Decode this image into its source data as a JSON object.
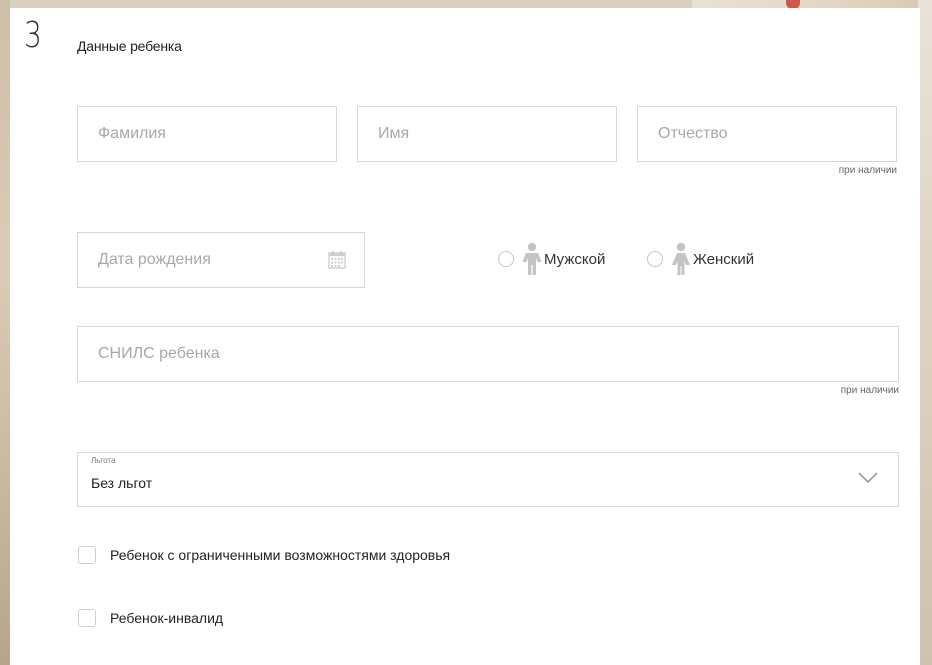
{
  "section": {
    "step": "3",
    "title": "Данные ребенка"
  },
  "fields": {
    "last_name_placeholder": "Фамилия",
    "first_name_placeholder": "Имя",
    "patronymic_placeholder": "Отчество",
    "patronymic_hint": "при наличии",
    "birth_date_placeholder": "Дата рождения",
    "snils_placeholder": "СНИЛС ребенка",
    "snils_hint": "при наличии"
  },
  "gender": {
    "male_label": "Мужской",
    "female_label": "Женский"
  },
  "benefit": {
    "label": "Льгота",
    "value": "Без льгот"
  },
  "checkboxes": {
    "limited_health": "Ребенок с ограниченными возможностями здоровья",
    "disabled": "Ребенок-инвалид"
  }
}
